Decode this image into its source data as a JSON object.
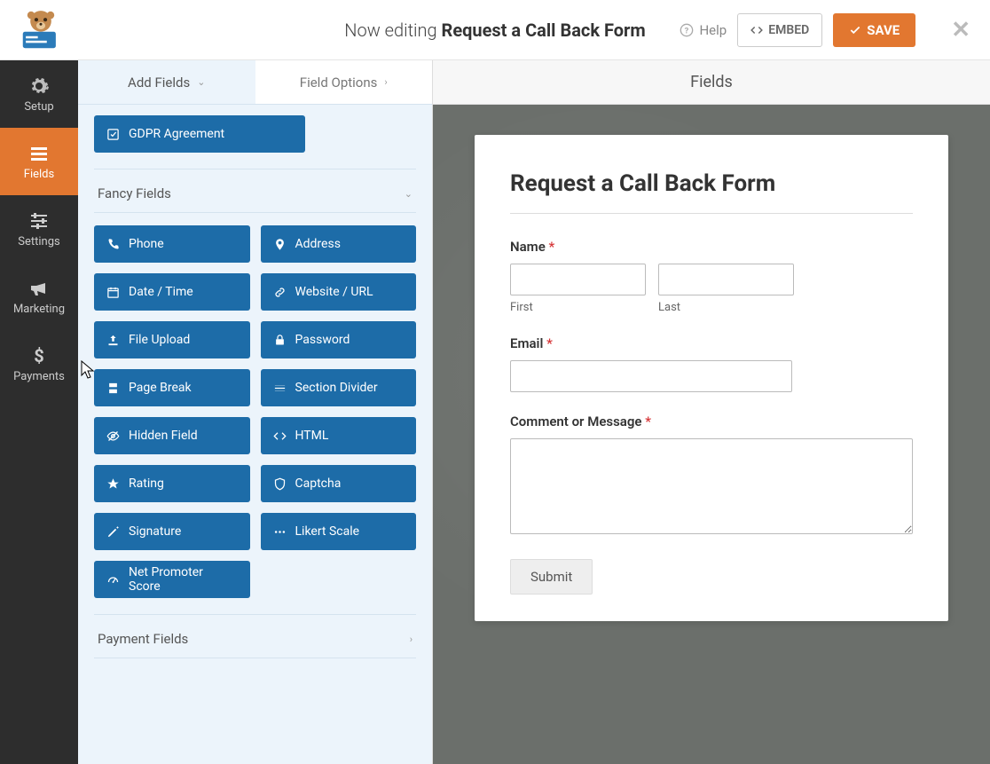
{
  "header": {
    "editing_prefix": "Now editing ",
    "form_name": "Request a Call Back Form",
    "help": "Help",
    "embed": "EMBED",
    "save": "SAVE"
  },
  "sidenav": {
    "setup": "Setup",
    "fields": "Fields",
    "settings": "Settings",
    "marketing": "Marketing",
    "payments": "Payments"
  },
  "panel": {
    "title": "Fields",
    "tab_add": "Add Fields",
    "tab_options": "Field Options",
    "gdpr": "GDPR Agreement",
    "fancy_header": "Fancy Fields",
    "payment_header": "Payment Fields",
    "fields": {
      "phone": "Phone",
      "address": "Address",
      "datetime": "Date / Time",
      "website": "Website / URL",
      "upload": "File Upload",
      "password": "Password",
      "pagebreak": "Page Break",
      "divider": "Section Divider",
      "hidden": "Hidden Field",
      "html": "HTML",
      "rating": "Rating",
      "captcha": "Captcha",
      "signature": "Signature",
      "likert": "Likert Scale",
      "nps": "Net Promoter Score"
    }
  },
  "preview": {
    "title": "Request a Call Back Form",
    "name_label": "Name",
    "first": "First",
    "last": "Last",
    "email_label": "Email",
    "comment_label": "Comment or Message",
    "submit": "Submit"
  }
}
